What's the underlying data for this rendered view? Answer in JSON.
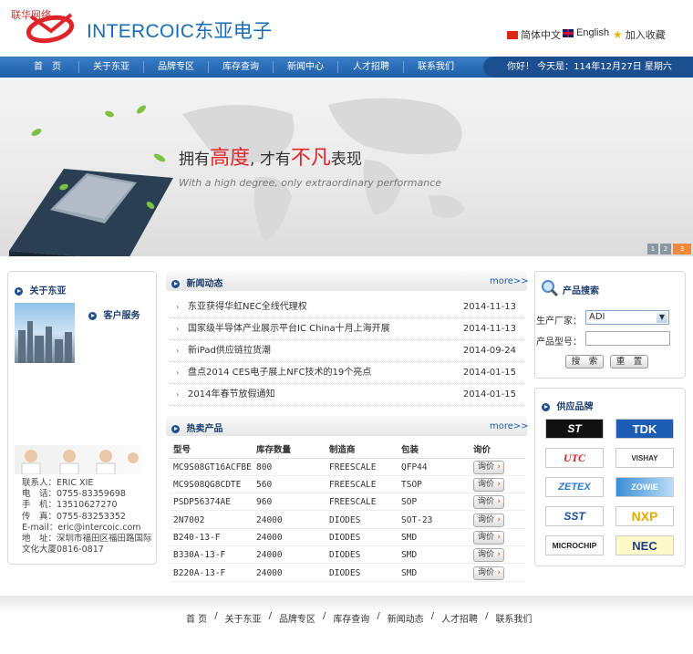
{
  "header": {
    "top_tag": "联华网络",
    "brand": "INTERCOIC东亚电子",
    "lang_cn": "简体中文",
    "lang_en": "English",
    "favorite": "加入收藏"
  },
  "nav": {
    "items": [
      "首　页",
      "关于东亚",
      "品牌专区",
      "库存查询",
      "新闻中心",
      "人才招聘",
      "联系我们"
    ],
    "greeting": "你好！ 今天是：114年12月27日  星期六"
  },
  "banner": {
    "slogan_a": "拥有",
    "slogan_b": "高度",
    "slogan_c": ", 才有",
    "slogan_d": "不凡",
    "slogan_e": "表现",
    "english": "With a high degree, only extraordinary performance",
    "pager": [
      "1",
      "2",
      "3"
    ]
  },
  "about": {
    "title": "关于东亚",
    "service": "客户服务",
    "contact": [
      "联系人：ERIC XIE",
      "电　话：0755-83359698",
      "手　机：13510627270",
      "传　真：0755-83253352",
      "E-mail：eric@intercoic.com",
      "地　址：深圳市福田区福田路国际",
      "文化大厦0816-0817"
    ]
  },
  "news": {
    "title": "新闻动态",
    "more": "more>>",
    "items": [
      {
        "title": "东亚获得华虹NEC全线代理权",
        "date": "2014-11-13"
      },
      {
        "title": "国家级半导体产业展示平台IC China十月上海开展",
        "date": "2014-11-13"
      },
      {
        "title": "新iPad供应链拉货潮",
        "date": "2014-09-24"
      },
      {
        "title": "盘点2014 CES电子展上NFC技术的19个亮点",
        "date": "2014-01-15"
      },
      {
        "title": "2014年春节放假通知",
        "date": "2014-01-15"
      }
    ]
  },
  "hot": {
    "title": "热卖产品",
    "more": "more>>",
    "columns": [
      "型号",
      "库存数量",
      "制造商",
      "包装",
      "询价"
    ],
    "ask": "询价",
    "rows": [
      [
        "MC9S08GT16ACFBE",
        "800",
        "FREESCALE",
        "QFP44"
      ],
      [
        "MC9S08QG8CDTE",
        "560",
        "FREESCALE",
        "TSOP"
      ],
      [
        "PSDP56374AE",
        "960",
        "FREESCALE",
        "SOP"
      ],
      [
        "2N7002",
        "24000",
        "DIODES",
        "SOT-23"
      ],
      [
        "B240-13-F",
        "24000",
        "DIODES",
        "SMD"
      ],
      [
        "B330A-13-F",
        "24000",
        "DIODES",
        "SMD"
      ],
      [
        "B220A-13-F",
        "24000",
        "DIODES",
        "SMD"
      ]
    ]
  },
  "search": {
    "title": "产品搜索",
    "maker_label": "生产厂家：",
    "maker_value": "ADI",
    "part_label": "产品型号：",
    "search_btn": "搜　索",
    "reset_btn": "重　置"
  },
  "brands": {
    "title": "供应品牌",
    "items": [
      "ST",
      "TDK",
      "UTC",
      "VISHAY",
      "ZETEX",
      "ZOWIE",
      "SST",
      "NXP",
      "MICROCHIP",
      "NEC"
    ]
  },
  "footer": {
    "links": [
      "首 页",
      "关于东亚",
      "品牌专区",
      "库存查询",
      "新闻动态",
      "人才招聘",
      "联系我们"
    ]
  },
  "colors": {
    "accent": "#1a6bb5",
    "nav": "#1f5ea6",
    "red": "#e0252a"
  }
}
